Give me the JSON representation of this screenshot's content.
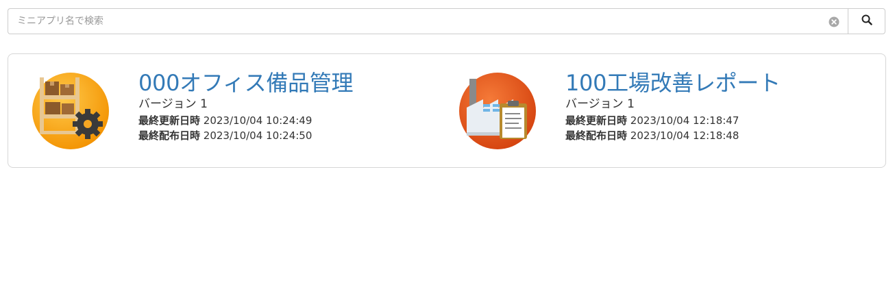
{
  "search": {
    "placeholder": "ミニアプリ名で検索",
    "value": ""
  },
  "apps": [
    {
      "title": "000オフィス備品管理",
      "version": "バージョン 1",
      "updated_label": "最終更新日時",
      "updated_value": "2023/10/04 10:24:49",
      "published_label": "最終配布日時",
      "published_value": "2023/10/04 10:24:50",
      "icon": "warehouse-gear-icon",
      "icon_color": "#f7a21b"
    },
    {
      "title": "100工場改善レポート",
      "version": "バージョン 1",
      "updated_label": "最終更新日時",
      "updated_value": "2023/10/04 12:18:47",
      "published_label": "最終配布日時",
      "published_value": "2023/10/04 12:18:48",
      "icon": "factory-clipboard-icon",
      "icon_color": "#e05a1a"
    }
  ],
  "colors": {
    "link": "#337ab7",
    "border": "#cccccc"
  }
}
